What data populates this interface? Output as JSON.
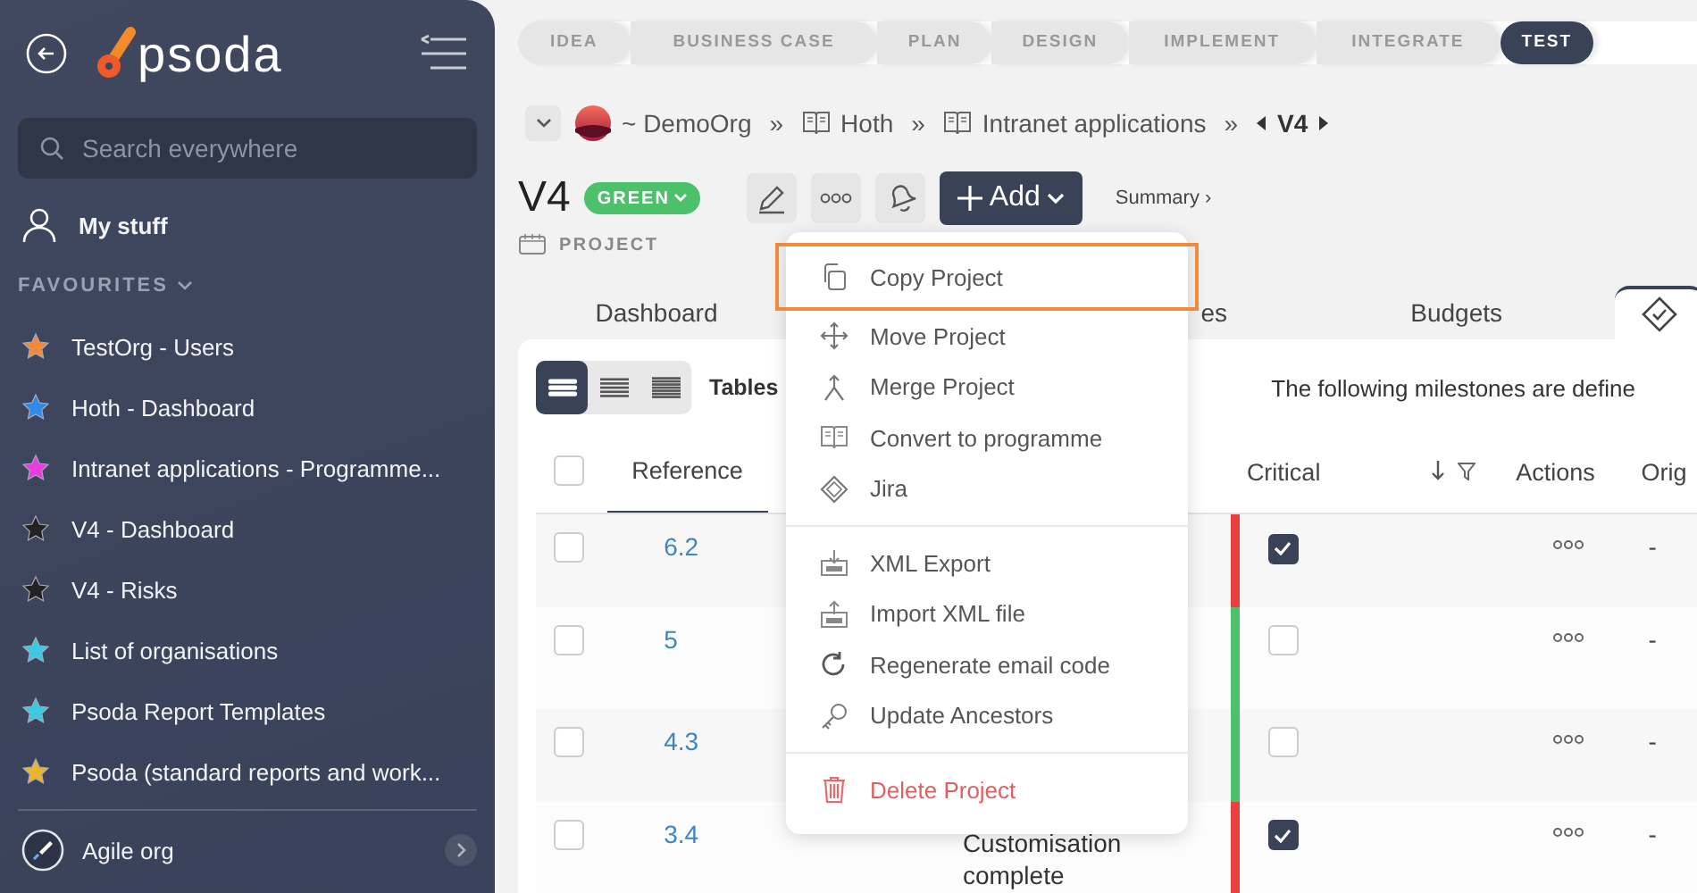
{
  "sidebar": {
    "logo": "psoda",
    "search": {
      "placeholder": "Search everywhere"
    },
    "my_stuff": "My stuff",
    "favourites_heading": "FAVOURITES",
    "favourites": [
      {
        "label": "TestOrg - Users",
        "color": "#f08a3c"
      },
      {
        "label": "Hoth - Dashboard",
        "color": "#2f8ce6"
      },
      {
        "label": "Intranet applications - Programme...",
        "color": "#e83ee0"
      },
      {
        "label": "V4 - Dashboard",
        "color": "#222222"
      },
      {
        "label": "V4 - Risks",
        "color": "#222222"
      },
      {
        "label": "List of organisations",
        "color": "#3cc8e0"
      },
      {
        "label": "Psoda Report Templates",
        "color": "#3cc8e0"
      },
      {
        "label": "Psoda (standard reports and work...",
        "color": "#e8b530"
      }
    ],
    "org": "Agile org"
  },
  "stages": [
    {
      "label": "IDEA",
      "selected": false
    },
    {
      "label": "BUSINESS CASE",
      "selected": false
    },
    {
      "label": "PLAN",
      "selected": false
    },
    {
      "label": "DESIGN",
      "selected": false
    },
    {
      "label": "IMPLEMENT",
      "selected": false
    },
    {
      "label": "INTEGRATE",
      "selected": false
    },
    {
      "label": "TEST",
      "selected": true
    }
  ],
  "breadcrumb": [
    {
      "kind": "org",
      "label": "~ DemoOrg"
    },
    {
      "kind": "separator",
      "label": "»"
    },
    {
      "kind": "programme",
      "label": "Hoth"
    },
    {
      "kind": "separator",
      "label": "»"
    },
    {
      "kind": "programme",
      "label": "Intranet applications"
    },
    {
      "kind": "separator",
      "label": "»"
    },
    {
      "kind": "current",
      "label": "V4"
    }
  ],
  "title": "V4",
  "status_badge": "GREEN",
  "type_label": "PROJECT",
  "add_button": "Add",
  "summary_link": "Summary ›",
  "tabs": [
    {
      "kind": "text",
      "label": "Dashboard",
      "selected": false
    },
    {
      "kind": "text",
      "label": "es",
      "selected": false
    },
    {
      "kind": "text",
      "label": "Budgets",
      "selected": false
    },
    {
      "kind": "icon",
      "selected": true
    }
  ],
  "content": {
    "views": [
      {
        "selected": true
      },
      {
        "selected": false
      },
      {
        "selected": false
      }
    ],
    "tables_label": "Tables",
    "intro": "The following milestones are define"
  },
  "table": {
    "columns": [
      "Reference",
      "Critical",
      "Actions",
      "Orig"
    ],
    "all_selected": false,
    "rows": [
      {
        "selected": false,
        "reference": "6.2",
        "color": "#e84040",
        "critical": true,
        "original": "-"
      },
      {
        "selected": false,
        "reference": "5",
        "color": "#4cc06a",
        "critical": false,
        "original": "-"
      },
      {
        "selected": false,
        "reference": "4.3",
        "color": "#4cc06a",
        "critical": false,
        "original": "-"
      },
      {
        "selected": false,
        "reference": "3.4",
        "description": "Customisation complete",
        "color": "#e84040",
        "critical": true,
        "original": "-"
      }
    ]
  },
  "menu": [
    {
      "kind": "item",
      "label": "Copy Project",
      "selected": true
    },
    {
      "kind": "item",
      "label": "Move Project",
      "selected": false
    },
    {
      "kind": "item",
      "label": "Merge Project",
      "selected": false
    },
    {
      "kind": "item",
      "label": "Convert to programme",
      "selected": false
    },
    {
      "kind": "item",
      "label": "Jira",
      "selected": false
    },
    {
      "kind": "divider"
    },
    {
      "kind": "item",
      "label": "XML Export",
      "selected": false
    },
    {
      "kind": "item",
      "label": "Import XML file",
      "selected": false
    },
    {
      "kind": "item",
      "label": "Regenerate email code",
      "selected": false
    },
    {
      "kind": "item",
      "label": "Update Ancestors",
      "selected": false
    },
    {
      "kind": "divider"
    },
    {
      "kind": "danger",
      "label": "Delete Project",
      "selected": false
    }
  ]
}
